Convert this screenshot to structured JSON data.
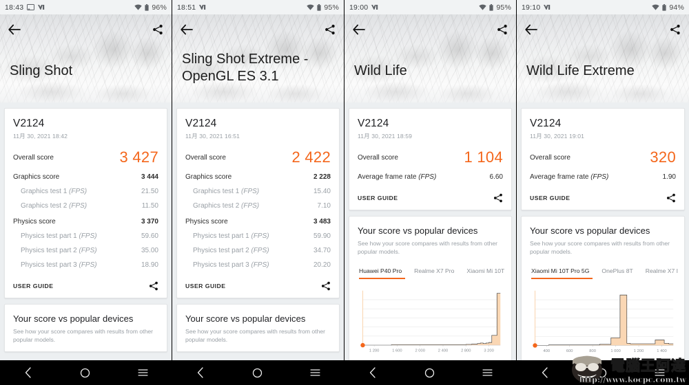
{
  "panels": [
    {
      "status": {
        "time": "18:43",
        "battery": "96%",
        "icons": [
          "cast-icon",
          "dnd-icon",
          "wifi-icon",
          "battery-icon"
        ]
      },
      "hero": {
        "title": "Sling Shot",
        "back": "back-arrow-icon",
        "share": "share-icon",
        "two_line": false
      },
      "result": {
        "device": "V2124",
        "date": "11月 30, 2021 18:42",
        "overall_label": "Overall score",
        "overall_value": "3 427",
        "rows": [
          {
            "label": "Graphics score",
            "italic": "",
            "value": "3 444",
            "sub": false
          },
          {
            "label": "Graphics test 1 ",
            "italic": "(FPS)",
            "value": "21.50",
            "sub": true
          },
          {
            "label": "Graphics test 2 ",
            "italic": "(FPS)",
            "value": "11.50",
            "sub": true
          },
          {
            "label": "Physics score",
            "italic": "",
            "value": "3 370",
            "sub": false
          },
          {
            "label": "Physics test part 1 ",
            "italic": "(FPS)",
            "value": "59.60",
            "sub": true
          },
          {
            "label": "Physics test part 2 ",
            "italic": "(FPS)",
            "value": "35.00",
            "sub": true
          },
          {
            "label": "Physics test part 3 ",
            "italic": "(FPS)",
            "value": "18.90",
            "sub": true
          }
        ],
        "user_guide": "USER GUIDE"
      },
      "compare": {
        "title": "Your score vs popular devices",
        "subtitle": "See how your score compares with results from other popular models.",
        "tabs": [],
        "chart": null
      }
    },
    {
      "status": {
        "time": "18:51",
        "battery": "95%",
        "icons": [
          "dnd-icon",
          "wifi-icon",
          "battery-icon"
        ]
      },
      "hero": {
        "title": "Sling Shot Extreme - OpenGL ES 3.1",
        "back": "back-arrow-icon",
        "share": "share-icon",
        "two_line": true
      },
      "result": {
        "device": "V2124",
        "date": "11月 30, 2021 16:51",
        "overall_label": "Overall score",
        "overall_value": "2 422",
        "rows": [
          {
            "label": "Graphics score",
            "italic": "",
            "value": "2 228",
            "sub": false
          },
          {
            "label": "Graphics test 1 ",
            "italic": "(FPS)",
            "value": "15.40",
            "sub": true
          },
          {
            "label": "Graphics test 2 ",
            "italic": "(FPS)",
            "value": "7.10",
            "sub": true
          },
          {
            "label": "Physics score",
            "italic": "",
            "value": "3 483",
            "sub": false
          },
          {
            "label": "Physics test part 1 ",
            "italic": "(FPS)",
            "value": "59.90",
            "sub": true
          },
          {
            "label": "Physics test part 2 ",
            "italic": "(FPS)",
            "value": "34.70",
            "sub": true
          },
          {
            "label": "Physics test part 3 ",
            "italic": "(FPS)",
            "value": "20.20",
            "sub": true
          }
        ],
        "user_guide": "USER GUIDE"
      },
      "compare": {
        "title": "Your score vs popular devices",
        "subtitle": "See how your score compares with results from other popular models.",
        "tabs": [],
        "chart": null
      }
    },
    {
      "status": {
        "time": "19:00",
        "battery": "95%",
        "icons": [
          "dnd-icon",
          "wifi-icon",
          "battery-icon"
        ]
      },
      "hero": {
        "title": "Wild Life",
        "back": "back-arrow-icon",
        "share": "share-icon",
        "two_line": false
      },
      "result": {
        "device": "V2124",
        "date": "11月 30, 2021 18:59",
        "overall_label": "Overall score",
        "overall_value": "1 104",
        "rows": [
          {
            "label": "Average frame rate ",
            "italic": "(FPS)",
            "value": "6.60",
            "sub": false,
            "avg": true
          }
        ],
        "user_guide": "USER GUIDE"
      },
      "compare": {
        "title": "Your score vs popular devices",
        "subtitle": "See how your score compares with results from other popular models.",
        "tabs": [
          "Huawei P40 Pro",
          "Realme X7 Pro",
          "Xiaomi Mi 10T"
        ],
        "active_tab": 0,
        "chart": "wildlife"
      }
    },
    {
      "status": {
        "time": "19:10",
        "battery": "94%",
        "icons": [
          "dnd-icon",
          "wifi-icon",
          "battery-icon"
        ]
      },
      "hero": {
        "title": "Wild Life Extreme",
        "back": "back-arrow-icon",
        "share": "share-icon",
        "two_line": false
      },
      "result": {
        "device": "V2124",
        "date": "11月 30, 2021 19:01",
        "overall_label": "Overall score",
        "overall_value": "320",
        "rows": [
          {
            "label": "Average frame rate ",
            "italic": "(FPS)",
            "value": "1.90",
            "sub": false,
            "avg": true
          }
        ],
        "user_guide": "USER GUIDE"
      },
      "compare": {
        "title": "Your score vs popular devices",
        "subtitle": "See how your score compares with results from other popular models.",
        "tabs": [
          "Xiaomi Mi 10T Pro 5G",
          "OnePlus 8T",
          "Realme X7 I"
        ],
        "active_tab": 0,
        "chart": "wildlife-extreme"
      }
    }
  ],
  "navbar": {
    "back": "nav-back-icon",
    "home": "nav-home-icon",
    "recents": "nav-recents-icon"
  },
  "watermark": {
    "text": "電腦王阿達",
    "url": "http://www.kocpc.com.tw"
  },
  "colors": {
    "accent": "#F4661B",
    "chart_fill": "#FAD7B4",
    "chart_line": "#3c3c3c",
    "card_bg": "#FFFFFF",
    "page_bg": "#ECEFF1"
  },
  "chart_data": [
    {
      "id": "wildlife",
      "type": "area",
      "title": "Your score vs popular devices",
      "xlabel": "",
      "ylabel": "",
      "tick_labels": [
        "1 200",
        "1 600",
        "2 000",
        "2 400",
        "2 800",
        "3 200"
      ],
      "xlim": [
        1000,
        3400
      ],
      "ylim": [
        0,
        100
      ],
      "grid": true,
      "marker_label": "1 104",
      "marker_x": 1104,
      "legend_position": "none",
      "x": [
        1000,
        1100,
        1200,
        1300,
        1400,
        1500,
        1600,
        1700,
        1800,
        1900,
        2000,
        2100,
        2200,
        2300,
        2400,
        2500,
        2600,
        2700,
        2800,
        2900,
        3000,
        3050,
        3100,
        3150,
        3200,
        3250,
        3300,
        3340,
        3400
      ],
      "values": [
        0,
        0,
        0,
        0,
        0,
        1,
        1,
        1,
        1,
        1,
        1,
        1,
        1,
        1,
        1,
        1,
        1,
        1,
        1.5,
        2,
        3,
        4,
        3,
        4,
        5,
        18,
        18,
        95,
        95
      ]
    },
    {
      "id": "wildlife-extreme",
      "type": "area",
      "title": "Your score vs popular devices",
      "xlabel": "",
      "ylabel": "",
      "tick_labels": [
        "400",
        "600",
        "800",
        "1 000",
        "1 200",
        "1 400"
      ],
      "xlim": [
        280,
        1500
      ],
      "ylim": [
        0,
        100
      ],
      "grid": true,
      "marker_label": "320",
      "marker_x": 320,
      "legend_position": "none",
      "x": [
        280,
        320,
        400,
        500,
        600,
        700,
        800,
        850,
        900,
        950,
        980,
        1000,
        1030,
        1060,
        1090,
        1120,
        1160,
        1200,
        1240,
        1280,
        1300,
        1340,
        1380,
        1420,
        1460,
        1500
      ],
      "values": [
        0,
        0,
        1,
        1,
        1,
        1,
        1,
        2,
        2,
        14,
        14,
        14,
        92,
        92,
        4,
        3,
        3,
        3,
        3,
        3,
        3,
        10,
        10,
        4,
        3,
        3
      ]
    }
  ]
}
